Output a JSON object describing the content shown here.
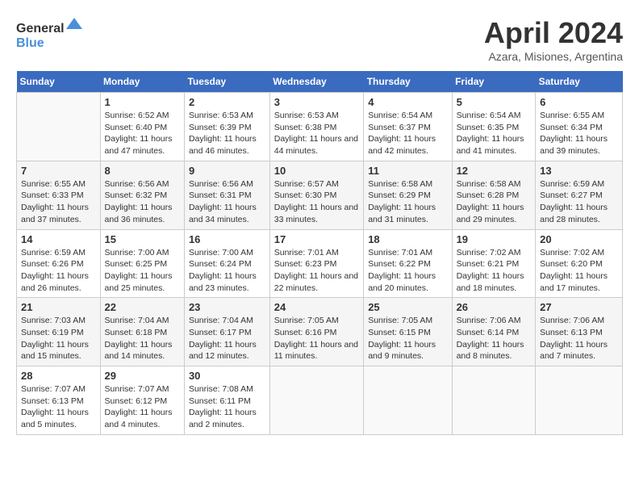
{
  "header": {
    "logo_general": "General",
    "logo_blue": "Blue",
    "title": "April 2024",
    "subtitle": "Azara, Misiones, Argentina"
  },
  "days_of_week": [
    "Sunday",
    "Monday",
    "Tuesday",
    "Wednesday",
    "Thursday",
    "Friday",
    "Saturday"
  ],
  "weeks": [
    [
      {
        "day": "",
        "sunrise": "",
        "sunset": "",
        "daylight": ""
      },
      {
        "day": "1",
        "sunrise": "Sunrise: 6:52 AM",
        "sunset": "Sunset: 6:40 PM",
        "daylight": "Daylight: 11 hours and 47 minutes."
      },
      {
        "day": "2",
        "sunrise": "Sunrise: 6:53 AM",
        "sunset": "Sunset: 6:39 PM",
        "daylight": "Daylight: 11 hours and 46 minutes."
      },
      {
        "day": "3",
        "sunrise": "Sunrise: 6:53 AM",
        "sunset": "Sunset: 6:38 PM",
        "daylight": "Daylight: 11 hours and 44 minutes."
      },
      {
        "day": "4",
        "sunrise": "Sunrise: 6:54 AM",
        "sunset": "Sunset: 6:37 PM",
        "daylight": "Daylight: 11 hours and 42 minutes."
      },
      {
        "day": "5",
        "sunrise": "Sunrise: 6:54 AM",
        "sunset": "Sunset: 6:35 PM",
        "daylight": "Daylight: 11 hours and 41 minutes."
      },
      {
        "day": "6",
        "sunrise": "Sunrise: 6:55 AM",
        "sunset": "Sunset: 6:34 PM",
        "daylight": "Daylight: 11 hours and 39 minutes."
      }
    ],
    [
      {
        "day": "7",
        "sunrise": "Sunrise: 6:55 AM",
        "sunset": "Sunset: 6:33 PM",
        "daylight": "Daylight: 11 hours and 37 minutes."
      },
      {
        "day": "8",
        "sunrise": "Sunrise: 6:56 AM",
        "sunset": "Sunset: 6:32 PM",
        "daylight": "Daylight: 11 hours and 36 minutes."
      },
      {
        "day": "9",
        "sunrise": "Sunrise: 6:56 AM",
        "sunset": "Sunset: 6:31 PM",
        "daylight": "Daylight: 11 hours and 34 minutes."
      },
      {
        "day": "10",
        "sunrise": "Sunrise: 6:57 AM",
        "sunset": "Sunset: 6:30 PM",
        "daylight": "Daylight: 11 hours and 33 minutes."
      },
      {
        "day": "11",
        "sunrise": "Sunrise: 6:58 AM",
        "sunset": "Sunset: 6:29 PM",
        "daylight": "Daylight: 11 hours and 31 minutes."
      },
      {
        "day": "12",
        "sunrise": "Sunrise: 6:58 AM",
        "sunset": "Sunset: 6:28 PM",
        "daylight": "Daylight: 11 hours and 29 minutes."
      },
      {
        "day": "13",
        "sunrise": "Sunrise: 6:59 AM",
        "sunset": "Sunset: 6:27 PM",
        "daylight": "Daylight: 11 hours and 28 minutes."
      }
    ],
    [
      {
        "day": "14",
        "sunrise": "Sunrise: 6:59 AM",
        "sunset": "Sunset: 6:26 PM",
        "daylight": "Daylight: 11 hours and 26 minutes."
      },
      {
        "day": "15",
        "sunrise": "Sunrise: 7:00 AM",
        "sunset": "Sunset: 6:25 PM",
        "daylight": "Daylight: 11 hours and 25 minutes."
      },
      {
        "day": "16",
        "sunrise": "Sunrise: 7:00 AM",
        "sunset": "Sunset: 6:24 PM",
        "daylight": "Daylight: 11 hours and 23 minutes."
      },
      {
        "day": "17",
        "sunrise": "Sunrise: 7:01 AM",
        "sunset": "Sunset: 6:23 PM",
        "daylight": "Daylight: 11 hours and 22 minutes."
      },
      {
        "day": "18",
        "sunrise": "Sunrise: 7:01 AM",
        "sunset": "Sunset: 6:22 PM",
        "daylight": "Daylight: 11 hours and 20 minutes."
      },
      {
        "day": "19",
        "sunrise": "Sunrise: 7:02 AM",
        "sunset": "Sunset: 6:21 PM",
        "daylight": "Daylight: 11 hours and 18 minutes."
      },
      {
        "day": "20",
        "sunrise": "Sunrise: 7:02 AM",
        "sunset": "Sunset: 6:20 PM",
        "daylight": "Daylight: 11 hours and 17 minutes."
      }
    ],
    [
      {
        "day": "21",
        "sunrise": "Sunrise: 7:03 AM",
        "sunset": "Sunset: 6:19 PM",
        "daylight": "Daylight: 11 hours and 15 minutes."
      },
      {
        "day": "22",
        "sunrise": "Sunrise: 7:04 AM",
        "sunset": "Sunset: 6:18 PM",
        "daylight": "Daylight: 11 hours and 14 minutes."
      },
      {
        "day": "23",
        "sunrise": "Sunrise: 7:04 AM",
        "sunset": "Sunset: 6:17 PM",
        "daylight": "Daylight: 11 hours and 12 minutes."
      },
      {
        "day": "24",
        "sunrise": "Sunrise: 7:05 AM",
        "sunset": "Sunset: 6:16 PM",
        "daylight": "Daylight: 11 hours and 11 minutes."
      },
      {
        "day": "25",
        "sunrise": "Sunrise: 7:05 AM",
        "sunset": "Sunset: 6:15 PM",
        "daylight": "Daylight: 11 hours and 9 minutes."
      },
      {
        "day": "26",
        "sunrise": "Sunrise: 7:06 AM",
        "sunset": "Sunset: 6:14 PM",
        "daylight": "Daylight: 11 hours and 8 minutes."
      },
      {
        "day": "27",
        "sunrise": "Sunrise: 7:06 AM",
        "sunset": "Sunset: 6:13 PM",
        "daylight": "Daylight: 11 hours and 7 minutes."
      }
    ],
    [
      {
        "day": "28",
        "sunrise": "Sunrise: 7:07 AM",
        "sunset": "Sunset: 6:13 PM",
        "daylight": "Daylight: 11 hours and 5 minutes."
      },
      {
        "day": "29",
        "sunrise": "Sunrise: 7:07 AM",
        "sunset": "Sunset: 6:12 PM",
        "daylight": "Daylight: 11 hours and 4 minutes."
      },
      {
        "day": "30",
        "sunrise": "Sunrise: 7:08 AM",
        "sunset": "Sunset: 6:11 PM",
        "daylight": "Daylight: 11 hours and 2 minutes."
      },
      {
        "day": "",
        "sunrise": "",
        "sunset": "",
        "daylight": ""
      },
      {
        "day": "",
        "sunrise": "",
        "sunset": "",
        "daylight": ""
      },
      {
        "day": "",
        "sunrise": "",
        "sunset": "",
        "daylight": ""
      },
      {
        "day": "",
        "sunrise": "",
        "sunset": "",
        "daylight": ""
      }
    ]
  ]
}
